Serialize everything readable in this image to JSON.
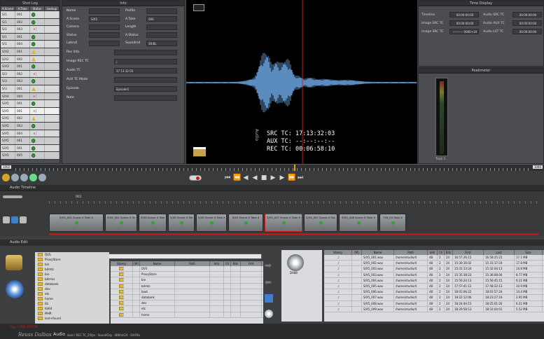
{
  "shot_log": {
    "title": "Shot Log",
    "columns": [
      "A.Scene",
      "A.Take",
      "Status",
      "Lookup"
    ],
    "rows": [
      {
        "scene": "S/1",
        "take": "001",
        "status": "ok"
      },
      {
        "scene": "S/1",
        "take": "002",
        "status": "ok"
      },
      {
        "scene": "S/1",
        "take": "003",
        "status": "x"
      },
      {
        "scene": "S/1",
        "take": "001",
        "status": "ok"
      },
      {
        "scene": "S/1",
        "take": "004",
        "status": "ok"
      },
      {
        "scene": "S/X2",
        "take": "001",
        "status": "w"
      },
      {
        "scene": "S/X2",
        "take": "002",
        "status": "w"
      },
      {
        "scene": "S/X3",
        "take": "001",
        "status": "ok"
      },
      {
        "scene": "S/3",
        "take": "002",
        "status": "x"
      },
      {
        "scene": "S/3",
        "take": "003",
        "status": "ok"
      },
      {
        "scene": "S/3",
        "take": "001",
        "status": "w"
      },
      {
        "scene": "S/X4",
        "take": "004",
        "status": "x"
      },
      {
        "scene": "S/X5",
        "take": "001",
        "status": "ok"
      },
      {
        "scene": "S/X5",
        "take": "001",
        "status": "x"
      },
      {
        "scene": "S/X5",
        "take": "002",
        "status": "w"
      },
      {
        "scene": "S/X5",
        "take": "003",
        "status": "ok"
      },
      {
        "scene": "S/X5",
        "take": "004",
        "status": "x"
      },
      {
        "scene": "S/X5",
        "take": "001",
        "status": "ok"
      },
      {
        "scene": "S/X5",
        "take": "001",
        "status": "ok"
      },
      {
        "scene": "S/X5",
        "take": "005",
        "status": "ok"
      }
    ]
  },
  "info": {
    "title": "Info",
    "fields": [
      {
        "label": "Name",
        "value": "",
        "label2": "Profile",
        "value2": ""
      },
      {
        "label": "A.Scene",
        "value": "S/X5",
        "label2": "A.Take",
        "value2": "006"
      },
      {
        "label": "Camera",
        "value": "",
        "label2": "Length",
        "value2": ""
      },
      {
        "label": "Status",
        "value": "",
        "label2": "A.Status",
        "value2": ""
      },
      {
        "label": "Labroll",
        "value": "",
        "label2": "Soundroll",
        "value2": "SR/BL"
      }
    ],
    "wide_fields": [
      {
        "label": "Rec Info",
        "value": ""
      },
      {
        "label": "Image REC TC",
        "value": "|"
      },
      {
        "label": "Audio TC",
        "value": "17 13 32 03"
      },
      {
        "label": "AUX TC Mode",
        "value": ""
      },
      {
        "label": "Episode",
        "value": "Episode1"
      },
      {
        "label": "Note",
        "value": ""
      }
    ]
  },
  "video": {
    "src_tc_label": "SRC TC:",
    "src_tc": "17:13:32:03",
    "aux_tc_label": "AUX TC:",
    "aux_tc": "--:--:--:--",
    "rec_tc_label": "REC TC:",
    "rec_tc": "00:06:58:10",
    "audio_vertical": "Audio"
  },
  "time_display": {
    "title": "Time Display",
    "rows": [
      {
        "l1": "Timeline",
        "v1": "00:00:00:00",
        "l2": "Audio SRC TC",
        "v2": "00:00:00:00"
      },
      {
        "l1": "Image SRC TC",
        "v1": "00:00:00:00",
        "l2": "Audio AUX TC",
        "v2": "00:00:00:00"
      },
      {
        "l1": "Image SRC TC",
        "v1": "---------- 0000+34",
        "l2": "Audio LST TC",
        "v2": "00:00:00:00"
      }
    ]
  },
  "peak": {
    "title": "Peakmeter",
    "track_label": "Track 1"
  },
  "ruler_left": "1002",
  "ruler_right": "1094",
  "audio_timeline": {
    "title": "Audio Timeline",
    "marker": "001",
    "clips": [
      {
        "name": "S/X5_001 Scene X Take X"
      },
      {
        "name": "S/X5_002 Scene X Take X"
      },
      {
        "name": "S/X5 Scene X Take X"
      },
      {
        "name": "S/X5 Scene X Take X"
      },
      {
        "name": "S/X5 Scene X Take X"
      },
      {
        "name": "S/X5 Scene X Take X"
      },
      {
        "name": "S/X5_007 Scene X Take X"
      },
      {
        "name": "S/X5_007 Scene X Take X"
      },
      {
        "name": "S/X5_008 Scene X Take X"
      },
      {
        "name": "T05_EX Take X"
      }
    ]
  },
  "audio_edit": {
    "title": "Audio Edit",
    "path_value": "",
    "tree": [
      "DVS",
      "ProxyStore",
      "bin",
      "bdmtc",
      "bin",
      "bdrmis",
      "databank",
      "dev",
      "etc",
      "home",
      "lib",
      "lib64",
      "MHR",
      "lost+found"
    ],
    "file_columns": [
      "Stamp",
      "(M)",
      "Name",
      "Path",
      "Info",
      "Ch",
      "Bits",
      "Fmt"
    ],
    "files": [
      "DVS",
      "ProxyStore",
      "bin",
      "bdmtc",
      "boot",
      "databank",
      "dev",
      "etc",
      "home"
    ],
    "media_icon_label": "DA88",
    "media_columns": [
      "Stamp",
      "(M)",
      "Name",
      "Path",
      "kHz",
      "Ch",
      "Bits",
      "First",
      "Last",
      "Size"
    ],
    "media": [
      {
        "name": "S/X5_001.wav",
        "path": "/home/studio/4",
        "khz": "48",
        "ch": "2",
        "bits": "24",
        "first": "16:57:26:15",
        "last": "16:58:25:23",
        "size": "17.1 MB"
      },
      {
        "name": "S/X5_002.wav",
        "path": "/home/studio/4",
        "khz": "48",
        "ch": "2",
        "bits": "24",
        "first": "15:30:16:02",
        "last": "15:31:17:24",
        "size": "17.8 MB"
      },
      {
        "name": "S/X5_003.wav",
        "path": "/home/studio/4",
        "khz": "48",
        "ch": "2",
        "bits": "24",
        "first": "15:31:13:24",
        "last": "15:32:04:13",
        "size": "14.8 MB"
      },
      {
        "name": "S/X5_003.wav",
        "path": "/home/studio/4",
        "khz": "48",
        "ch": "2",
        "bits": "24",
        "first": "15:35:38:23",
        "last": "15:36:08:00",
        "size": "8.77 MB"
      },
      {
        "name": "S/X5_004.wav",
        "path": "/home/studio/4",
        "khz": "48",
        "ch": "2",
        "bits": "24",
        "first": "15:56:24:13",
        "last": "15:56:45:15",
        "size": "6.21 MB"
      },
      {
        "name": "S/X5_005.wav",
        "path": "/home/studio/4",
        "khz": "48",
        "ch": "2",
        "bits": "24",
        "first": "17:57:41:12",
        "last": "17:58:22:13",
        "size": "10.9 MB"
      },
      {
        "name": "S/X5_006.wav",
        "path": "/home/studio/4",
        "khz": "48",
        "ch": "2",
        "bits": "24",
        "first": "18:01:06:22",
        "last": "18:01:57:24",
        "size": "14.4 MB"
      },
      {
        "name": "S/X5_007.wav",
        "path": "/home/studio/4",
        "khz": "48",
        "ch": "2",
        "bits": "24",
        "first": "18:22:12:06",
        "last": "18:23:27:16",
        "size": "2.95 MB"
      },
      {
        "name": "S/X5_008.wav",
        "path": "/home/studio/4",
        "khz": "48",
        "ch": "2",
        "bits": "24",
        "first": "18:24:44:15",
        "last": "18:25:01:20",
        "size": "6.21 MB"
      },
      {
        "name": "S/X5_009.wav",
        "path": "/home/studio/4",
        "khz": "48",
        "ch": "2",
        "bits": "24",
        "first": "18:29:58:13",
        "last": "18:31:04:01",
        "size": "5.52 MB"
      }
    ]
  },
  "status_bar": {
    "warning": "Log / LINK ERROR",
    "brand": "Reuss Dalbas",
    "app": "Audio",
    "info": "dual / REC TC_25fps · SoundOrg · 48Khz/24 · SVIF6a"
  },
  "colors": {
    "accent": "#d21a1a",
    "ok": "#2fa32f",
    "warn": "#e4b422",
    "waveform": "#5b8cc0",
    "wave_line": "#d21a1a"
  }
}
